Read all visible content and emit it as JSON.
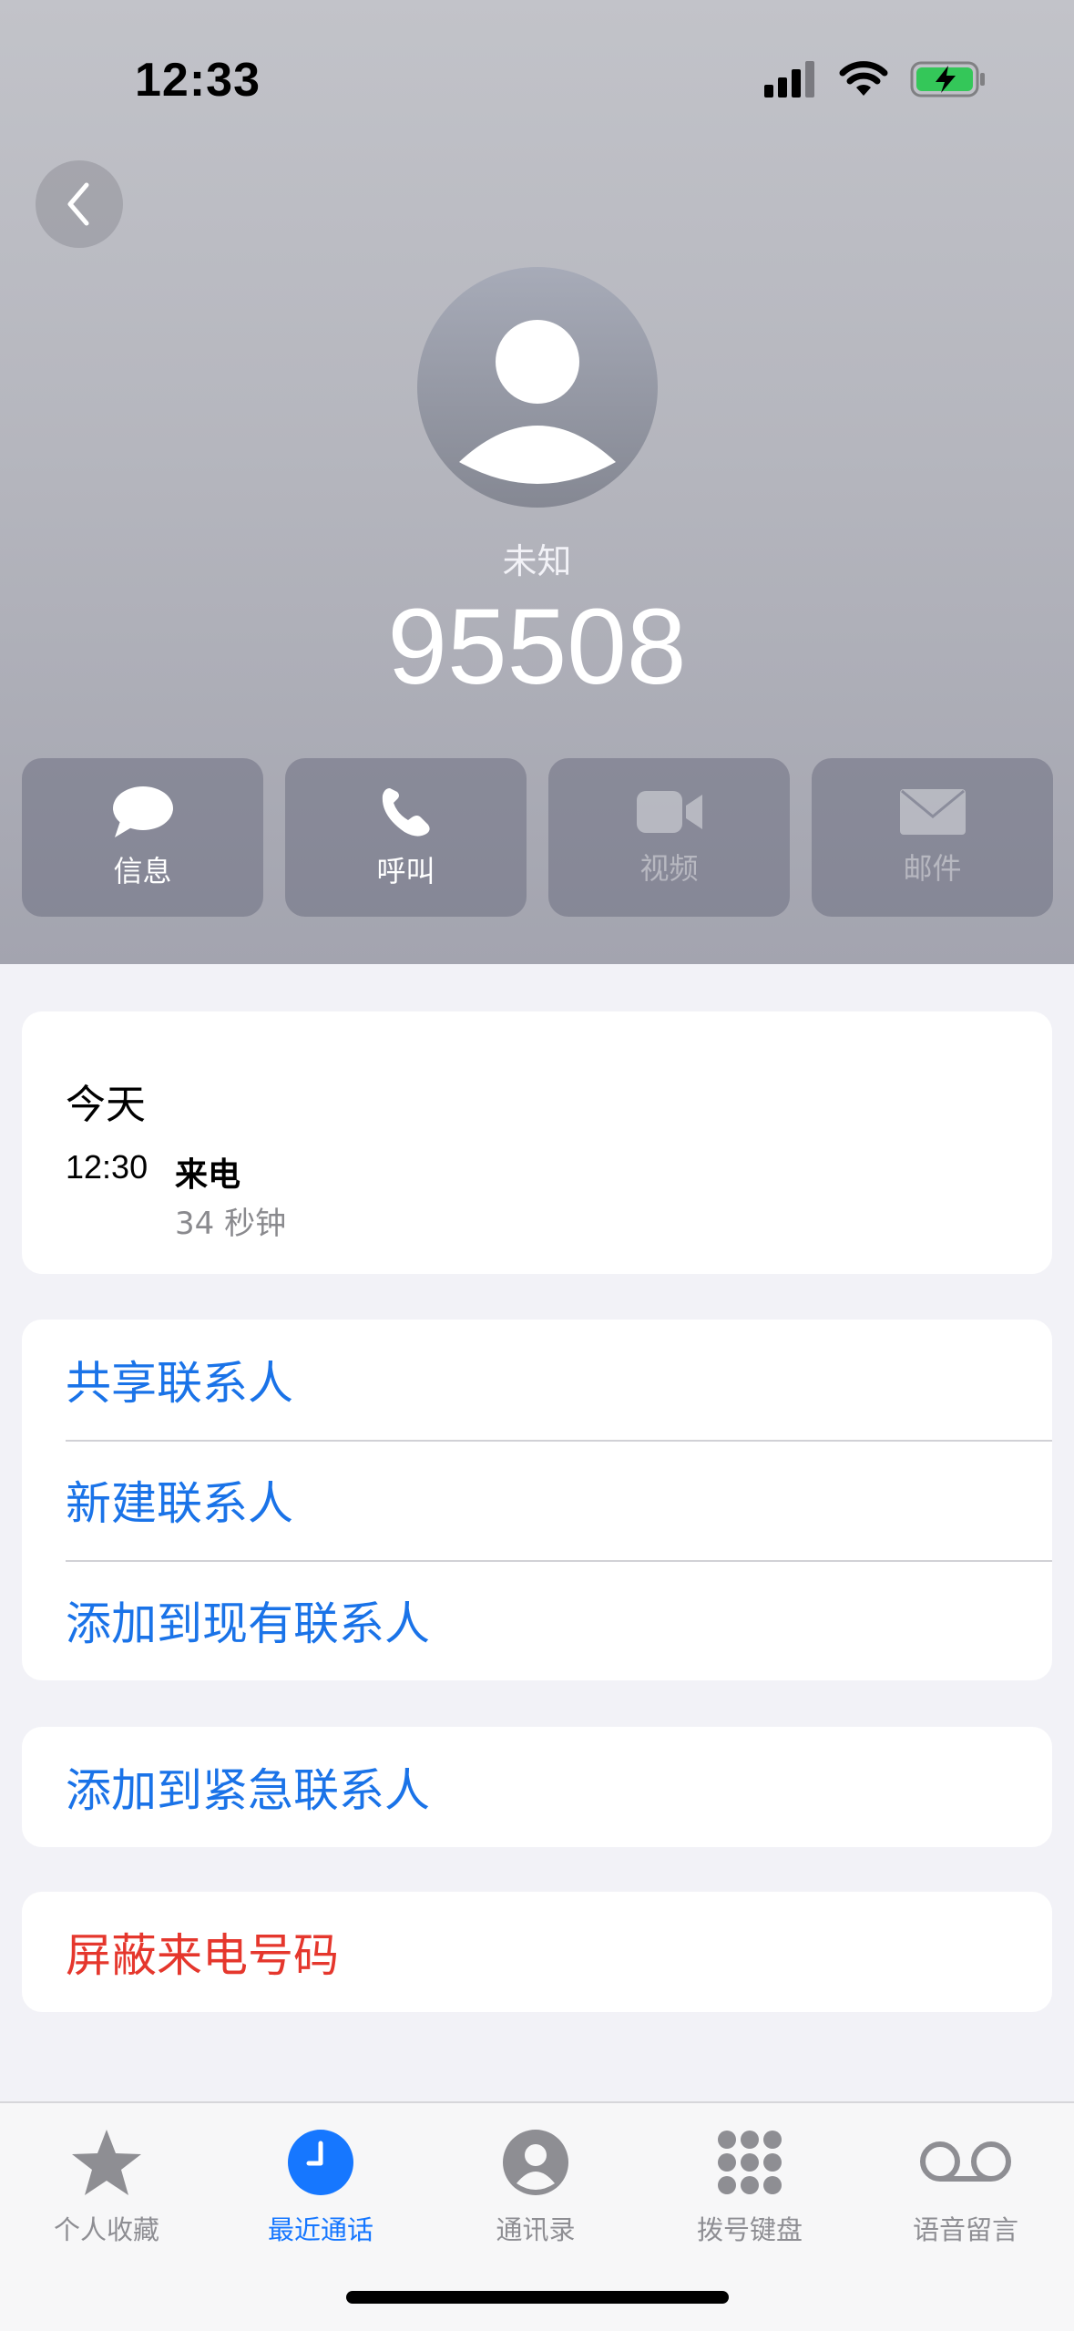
{
  "status_bar": {
    "time": "12:33",
    "icons": [
      "signal-icon",
      "wifi-icon",
      "battery-charging-icon"
    ]
  },
  "caller": {
    "label": "未知",
    "number": "95508"
  },
  "actions": [
    {
      "label": "信息",
      "icon": "message-icon",
      "enabled": true
    },
    {
      "label": "呼叫",
      "icon": "phone-icon",
      "enabled": true
    },
    {
      "label": "视频",
      "icon": "video-icon",
      "enabled": false
    },
    {
      "label": "邮件",
      "icon": "mail-icon",
      "enabled": false
    }
  ],
  "call_history": {
    "title": "今天",
    "entries": [
      {
        "time": "12:30",
        "type": "来电",
        "duration": "34 秒钟"
      }
    ]
  },
  "contact_options": [
    "共享联系人",
    "新建联系人",
    "添加到现有联系人"
  ],
  "emergency_option": "添加到紧急联系人",
  "block_option": "屏蔽来电号码",
  "tab_bar": {
    "tabs": [
      {
        "label": "个人收藏",
        "icon": "star-icon"
      },
      {
        "label": "最近通话",
        "icon": "clock-icon",
        "active": true
      },
      {
        "label": "通讯录",
        "icon": "contacts-icon"
      },
      {
        "label": "拨号键盘",
        "icon": "keypad-icon"
      },
      {
        "label": "语音留言",
        "icon": "voicemail-icon"
      }
    ]
  },
  "colors": {
    "accent_blue": "#1a73e8",
    "tab_active": "#1677ff",
    "destructive_red": "#e5372d",
    "battery_green": "#34c759"
  }
}
